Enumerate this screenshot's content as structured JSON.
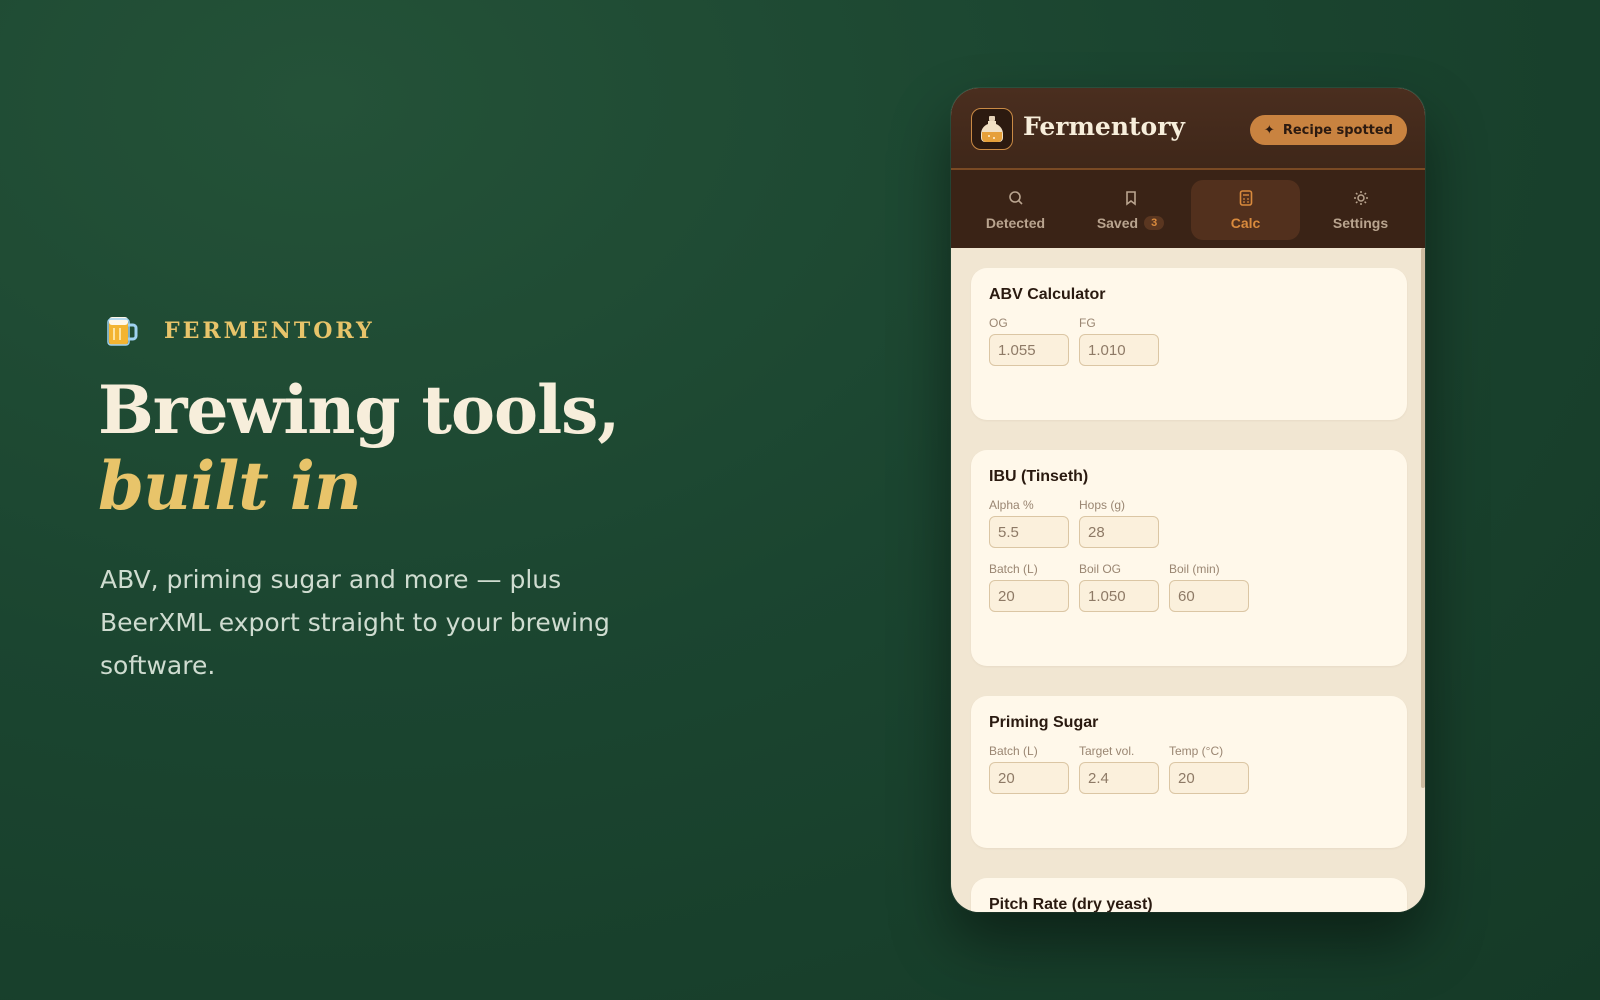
{
  "hero": {
    "brand": "FERMENTORY",
    "headline_line1": "Brewing tools,",
    "headline_line2": "built in",
    "description": "ABV, priming sugar and more — plus BeerXML export straight to your brewing software."
  },
  "popup": {
    "title": "Fermentory",
    "recipe_pill": "Recipe spotted",
    "recipe_pill_icon": "sparkle-icon",
    "tabs": [
      {
        "label": "Detected",
        "icon": "search-icon"
      },
      {
        "label": "Saved",
        "icon": "bookmark-icon",
        "badge": "3"
      },
      {
        "label": "Calc",
        "icon": "calculator-icon",
        "active": true
      },
      {
        "label": "Settings",
        "icon": "gear-icon"
      }
    ],
    "cards": [
      {
        "title": "ABV Calculator",
        "rows": [
          [
            {
              "label": "OG",
              "value": "1.055"
            },
            {
              "label": "FG",
              "value": "1.010"
            }
          ]
        ]
      },
      {
        "title": "IBU (Tinseth)",
        "rows": [
          [
            {
              "label": "Alpha %",
              "value": "5.5"
            },
            {
              "label": "Hops (g)",
              "value": "28"
            }
          ],
          [
            {
              "label": "Batch (L)",
              "value": "20"
            },
            {
              "label": "Boil OG",
              "value": "1.050"
            },
            {
              "label": "Boil (min)",
              "value": "60"
            }
          ]
        ]
      },
      {
        "title": "Priming Sugar",
        "rows": [
          [
            {
              "label": "Batch (L)",
              "value": "20"
            },
            {
              "label": "Target vol.",
              "value": "2.4"
            },
            {
              "label": "Temp (°C)",
              "value": "20"
            }
          ]
        ]
      },
      {
        "title": "Pitch Rate (dry yeast)",
        "rows": []
      }
    ]
  },
  "colors": {
    "background": "#1b4530",
    "accent_gold": "#e8c46a",
    "accent_copper": "#c98340",
    "header_brown": "#4a2e1f"
  }
}
